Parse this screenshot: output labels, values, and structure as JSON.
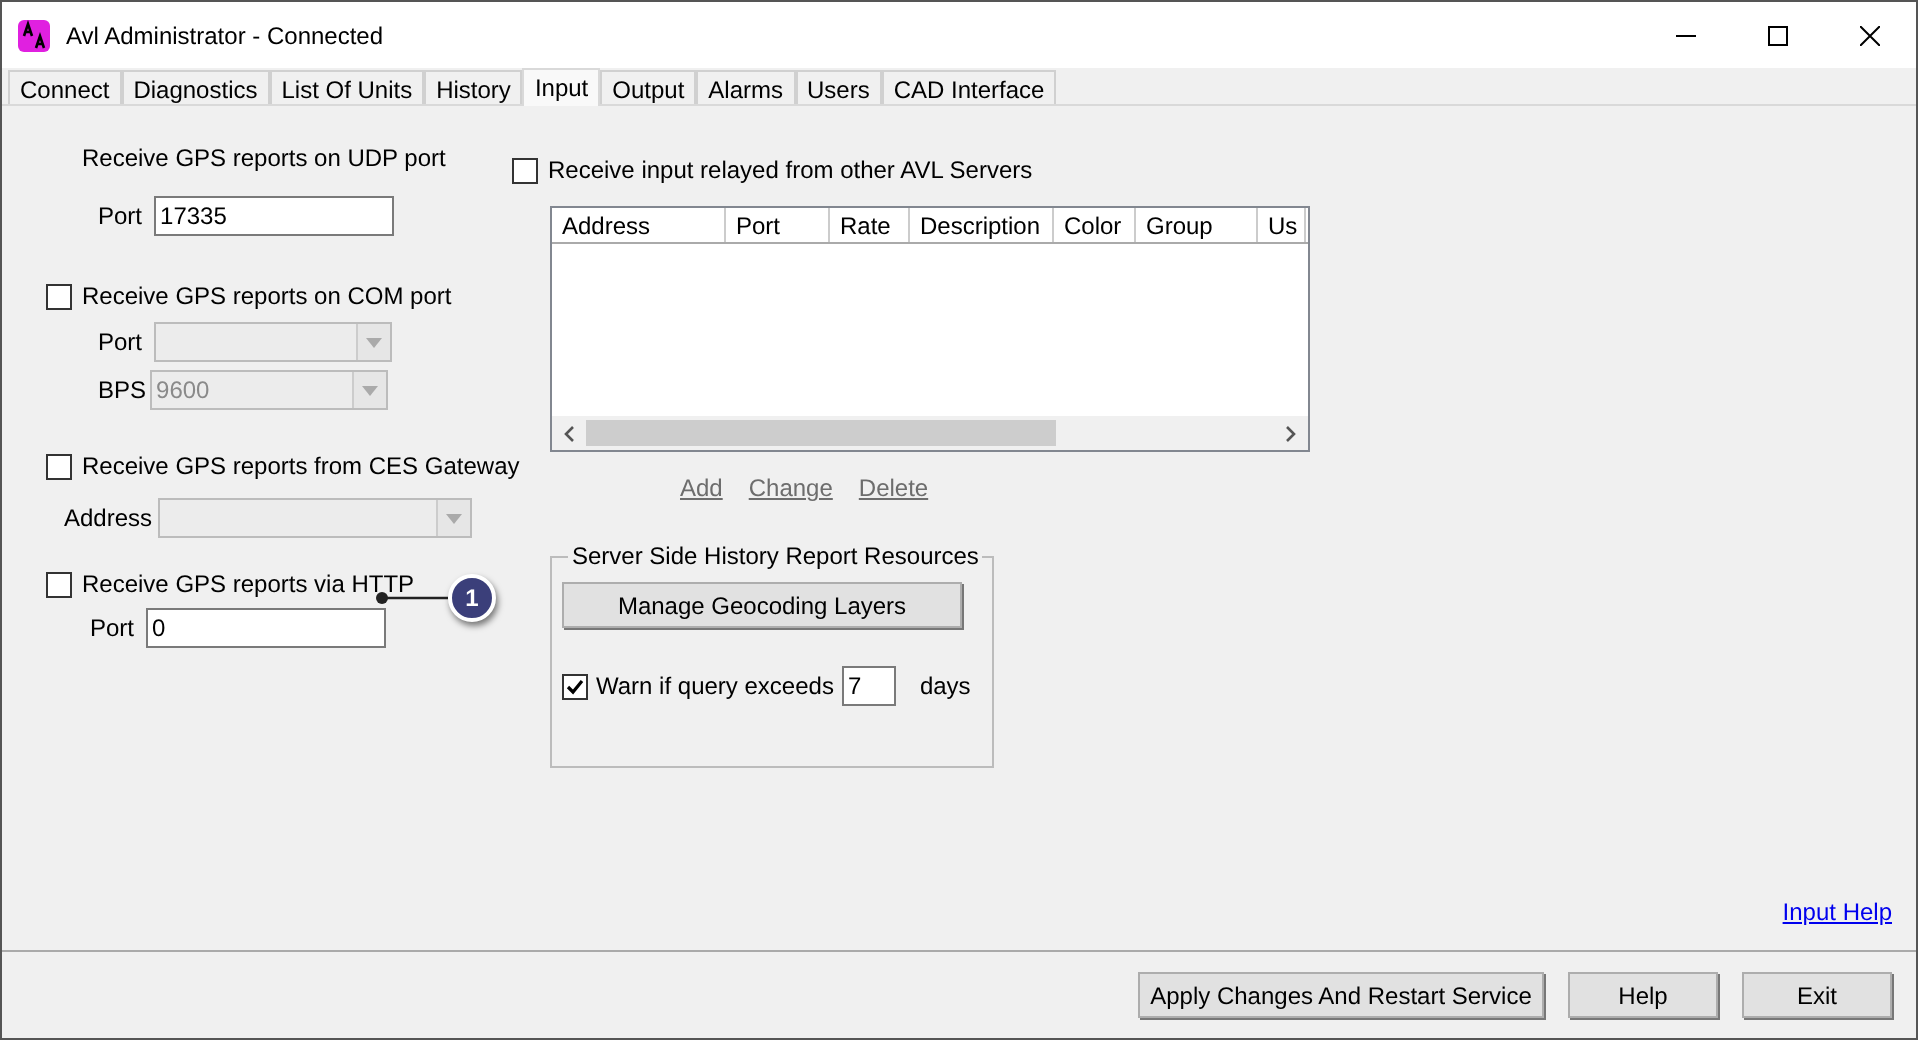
{
  "window": {
    "title": "Avl Administrator - Connected"
  },
  "tabs": [
    {
      "label": "Connect",
      "selected": false
    },
    {
      "label": "Diagnostics",
      "selected": false
    },
    {
      "label": "List Of Units",
      "selected": false
    },
    {
      "label": "History",
      "selected": false
    },
    {
      "label": "Input",
      "selected": true
    },
    {
      "label": "Output",
      "selected": false
    },
    {
      "label": "Alarms",
      "selected": false
    },
    {
      "label": "Users",
      "selected": false
    },
    {
      "label": "CAD Interface",
      "selected": false
    }
  ],
  "udp": {
    "label": "Receive GPS reports on UDP port",
    "port_label": "Port",
    "port_value": "17335"
  },
  "com": {
    "label": "Receive GPS reports on COM port",
    "checked": false,
    "port_label": "Port",
    "port_disabled": true,
    "bps_label": "BPS",
    "bps_value": "9600",
    "bps_disabled": true
  },
  "ces": {
    "label": "Receive GPS reports from CES Gateway",
    "checked": false,
    "address_label": "Address",
    "address_disabled": true
  },
  "http": {
    "label": "Receive GPS reports via HTTP",
    "checked": false,
    "port_label": "Port",
    "port_value": "0"
  },
  "callout": {
    "label": "1"
  },
  "relay": {
    "label": "Receive input relayed from other AVL Servers",
    "checked": false,
    "columns": [
      "Address",
      "Port",
      "Rate",
      "Description",
      "Color",
      "Group",
      "Us"
    ],
    "links": [
      "Add",
      "Change",
      "Delete"
    ]
  },
  "history": {
    "title": "Server Side History Report Resources",
    "button": "Manage Geocoding Layers",
    "warn_label": "Warn if query exceeds",
    "warn_checked": true,
    "warn_value": "7",
    "warn_unit": "days"
  },
  "help_link": "Input Help",
  "buttons": [
    "Apply Changes And Restart Service",
    "Help",
    "Exit"
  ]
}
